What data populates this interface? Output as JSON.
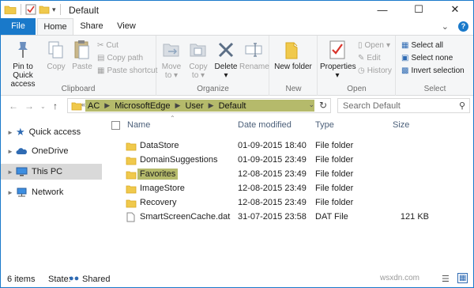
{
  "window": {
    "title": "Default"
  },
  "tabs": {
    "file": "File",
    "home": "Home",
    "share": "Share",
    "view": "View"
  },
  "ribbon": {
    "clipboard": {
      "label": "Clipboard",
      "pin": "Pin to Quick access",
      "copy": "Copy",
      "paste": "Paste",
      "cut": "Cut",
      "copy_path": "Copy path",
      "paste_shortcut": "Paste shortcut"
    },
    "organize": {
      "label": "Organize",
      "move_to": "Move to",
      "copy_to": "Copy to",
      "delete": "Delete",
      "rename": "Rename"
    },
    "new": {
      "label": "New",
      "new_folder": "New folder"
    },
    "open": {
      "label": "Open",
      "properties": "Properties",
      "open": "Open",
      "edit": "Edit",
      "history": "History"
    },
    "select": {
      "label": "Select",
      "select_all": "Select all",
      "select_none": "Select none",
      "invert": "Invert selection"
    }
  },
  "address": {
    "crumbs": [
      "AC",
      "MicrosoftEdge",
      "User",
      "Default"
    ],
    "search_placeholder": "Search Default"
  },
  "nav": {
    "items": [
      {
        "label": "Quick access",
        "icon": "star-icon"
      },
      {
        "label": "OneDrive",
        "icon": "cloud-icon"
      },
      {
        "label": "This PC",
        "icon": "computer-icon"
      },
      {
        "label": "Network",
        "icon": "network-icon"
      }
    ]
  },
  "columns": {
    "name": "Name",
    "date": "Date modified",
    "type": "Type",
    "size": "Size"
  },
  "files": [
    {
      "name": "DataStore",
      "date": "01-09-2015 18:40",
      "type": "File folder",
      "size": ""
    },
    {
      "name": "DomainSuggestions",
      "date": "01-09-2015 23:49",
      "type": "File folder",
      "size": ""
    },
    {
      "name": "Favorites",
      "date": "12-08-2015 23:49",
      "type": "File folder",
      "size": ""
    },
    {
      "name": "ImageStore",
      "date": "12-08-2015 23:49",
      "type": "File folder",
      "size": ""
    },
    {
      "name": "Recovery",
      "date": "12-08-2015 23:49",
      "type": "File folder",
      "size": ""
    },
    {
      "name": "SmartScreenCache.dat",
      "date": "31-07-2015 23:58",
      "type": "DAT File",
      "size": "121 KB"
    }
  ],
  "status": {
    "count": "6 items",
    "state_label": "State:",
    "state_value": "Shared"
  },
  "watermark": "wsxdn.com"
}
